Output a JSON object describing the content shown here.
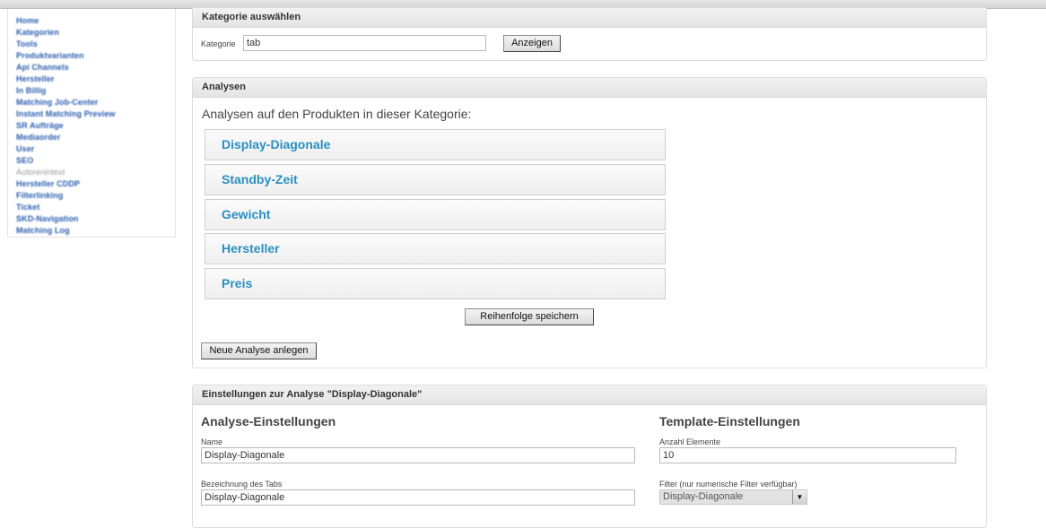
{
  "sidebar": {
    "items": [
      {
        "label": "Home"
      },
      {
        "label": "Kategorien"
      },
      {
        "label": "Tools"
      },
      {
        "label": "Produktvarianten"
      },
      {
        "label": "Api Channels"
      },
      {
        "label": "Hersteller"
      },
      {
        "label": "In Billig"
      },
      {
        "label": "Matching Job-Center"
      },
      {
        "label": "Instant Matching Preview"
      },
      {
        "label": "SR Aufträge"
      },
      {
        "label": "Mediaorder"
      },
      {
        "label": "User"
      },
      {
        "label": "SEO"
      },
      {
        "label": "Autorenintext"
      },
      {
        "label": "Hersteller CDDP"
      },
      {
        "label": "Filterlinking"
      },
      {
        "label": "Ticket"
      },
      {
        "label": "SKD-Navigation"
      },
      {
        "label": "Matching Log"
      }
    ]
  },
  "category_panel": {
    "title": "Kategorie auswählen",
    "field_label": "Kategorie",
    "field_value": "tab",
    "show_button": "Anzeigen"
  },
  "analyses_panel": {
    "title": "Analysen",
    "intro": "Analysen auf den Produkten in dieser Kategorie:",
    "items": [
      {
        "label": "Display-Diagonale"
      },
      {
        "label": "Standby-Zeit"
      },
      {
        "label": "Gewicht"
      },
      {
        "label": "Hersteller"
      },
      {
        "label": "Preis"
      }
    ],
    "save_order_button": "Reihenfolge speichern",
    "new_analysis_button": "Neue Analyse anlegen"
  },
  "settings_panel": {
    "title": "Einstellungen zur Analyse \"Display-Diagonale\"",
    "analysis_settings": {
      "heading": "Analyse-Einstellungen",
      "name_label": "Name",
      "name_value": "Display-Diagonale",
      "tab_label": "Bezeichnung des Tabs",
      "tab_value": "Display-Diagonale"
    },
    "template_settings": {
      "heading": "Template-Einstellungen",
      "count_label": "Anzahl Elemente",
      "count_value": "10",
      "filter_label": "Filter (nur numerische Filter verfügbar)",
      "filter_value": "Display-Diagonale"
    }
  }
}
